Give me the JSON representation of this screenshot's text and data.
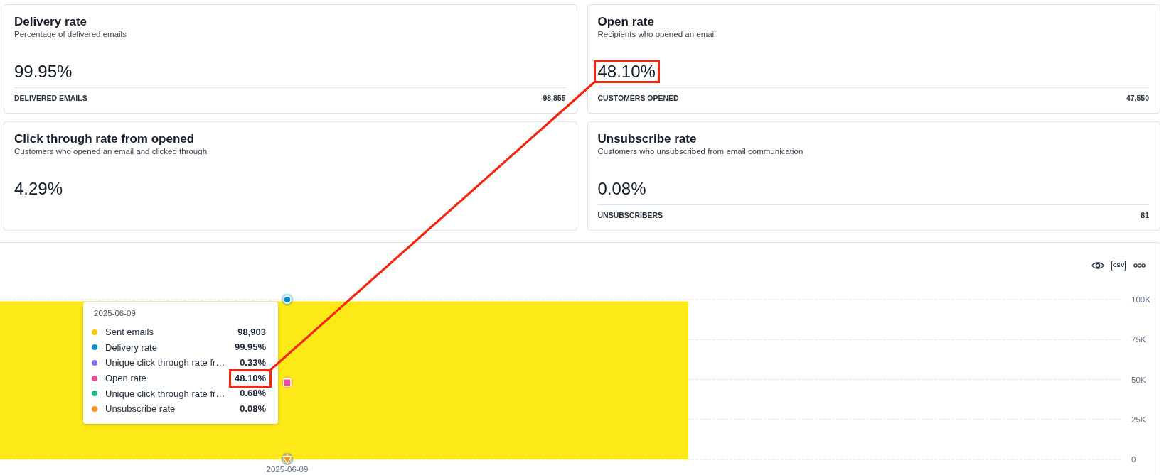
{
  "cards": [
    {
      "title": "Delivery rate",
      "subtitle": "Percentage of delivered emails",
      "value": "99.95%",
      "highlighted": false,
      "footer": {
        "label": "DELIVERED EMAILS",
        "value": "98,855"
      }
    },
    {
      "title": "Open rate",
      "subtitle": "Recipients who opened an email",
      "value": "48.10%",
      "highlighted": true,
      "footer": {
        "label": "CUSTOMERS OPENED",
        "value": "47,550"
      }
    },
    {
      "title": "Click through rate from opened",
      "subtitle": "Customers who opened an email and clicked through",
      "value": "4.29%",
      "highlighted": false
    },
    {
      "title": "Unsubscribe rate",
      "subtitle": "Customers who unsubscribed from email communication",
      "value": "0.08%",
      "highlighted": false,
      "footer": {
        "label": "UNSUBSCRIBERS",
        "value": "81"
      }
    }
  ],
  "chart_panel": {
    "toolbar": [
      {
        "kind": "view"
      },
      {
        "kind": "csv",
        "label": "CSV"
      },
      {
        "kind": "more"
      }
    ],
    "chart_data": {
      "type": "bar",
      "categories": [
        "2025-06-09"
      ],
      "ylim": [
        0,
        100000
      ],
      "yticks": [
        {
          "value": 0,
          "label": "0"
        },
        {
          "value": 25000,
          "label": "25K"
        },
        {
          "value": 50000,
          "label": "50K"
        },
        {
          "value": 75000,
          "label": "75K"
        },
        {
          "value": 100000,
          "label": "100K"
        }
      ],
      "grid": true,
      "series": [
        {
          "color": "#fde918",
          "values": [
            98903
          ]
        }
      ]
    },
    "tooltip": {
      "date": "2025-06-09",
      "rows": [
        {
          "label": "Sent emails",
          "value": "98,903",
          "color": "#fcca0d",
          "highlighted": false
        },
        {
          "label": "Delivery rate",
          "value": "99.95%",
          "color": "#0b8dcd",
          "highlighted": false
        },
        {
          "label": "Unique click through rate fr…",
          "value": "0.33%",
          "color": "#8b6cf6",
          "highlighted": false
        },
        {
          "label": "Open rate",
          "value": "48.10%",
          "color": "#ec4899",
          "highlighted": true
        },
        {
          "label": "Unique click through rate fr…",
          "value": "0.68%",
          "color": "#12b886",
          "highlighted": false
        },
        {
          "label": "Unsubscribe rate",
          "value": "0.08%",
          "color": "#f7931a",
          "highlighted": false
        }
      ]
    }
  }
}
